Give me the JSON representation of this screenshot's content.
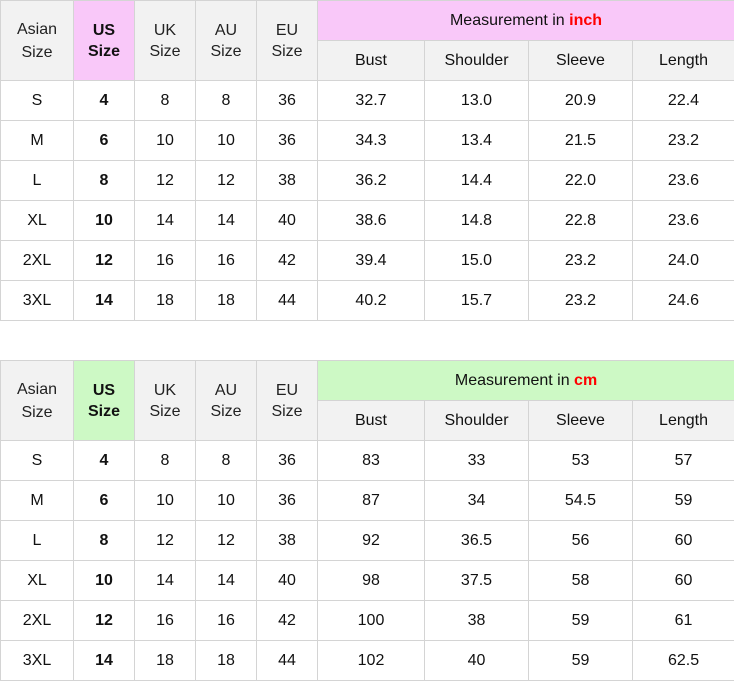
{
  "header": {
    "asian": [
      "Asian",
      "Size"
    ],
    "us": [
      "US",
      "Size"
    ],
    "uk": [
      "UK",
      "Size"
    ],
    "au": [
      "AU",
      "Size"
    ],
    "eu": [
      "EU",
      "Size"
    ],
    "measurement_prefix": "Measurement in",
    "sub_headers": [
      "Bust",
      "Shoulder",
      "Sleeve",
      "Length"
    ]
  },
  "tables": [
    {
      "unit": "inch",
      "accent_color": "#f9c8f9",
      "rows": [
        [
          "S",
          "4",
          "8",
          "8",
          "36",
          "32.7",
          "13.0",
          "20.9",
          "22.4"
        ],
        [
          "M",
          "6",
          "10",
          "10",
          "36",
          "34.3",
          "13.4",
          "21.5",
          "23.2"
        ],
        [
          "L",
          "8",
          "12",
          "12",
          "38",
          "36.2",
          "14.4",
          "22.0",
          "23.6"
        ],
        [
          "XL",
          "10",
          "14",
          "14",
          "40",
          "38.6",
          "14.8",
          "22.8",
          "23.6"
        ],
        [
          "2XL",
          "12",
          "16",
          "16",
          "42",
          "39.4",
          "15.0",
          "23.2",
          "24.0"
        ],
        [
          "3XL",
          "14",
          "18",
          "18",
          "44",
          "40.2",
          "15.7",
          "23.2",
          "24.6"
        ]
      ]
    },
    {
      "unit": "cm",
      "accent_color": "#cdf9c5",
      "rows": [
        [
          "S",
          "4",
          "8",
          "8",
          "36",
          "83",
          "33",
          "53",
          "57"
        ],
        [
          "M",
          "6",
          "10",
          "10",
          "36",
          "87",
          "34",
          "54.5",
          "59"
        ],
        [
          "L",
          "8",
          "12",
          "12",
          "38",
          "92",
          "36.5",
          "56",
          "60"
        ],
        [
          "XL",
          "10",
          "14",
          "14",
          "40",
          "98",
          "37.5",
          "58",
          "60"
        ],
        [
          "2XL",
          "12",
          "16",
          "16",
          "42",
          "100",
          "38",
          "59",
          "61"
        ],
        [
          "3XL",
          "14",
          "18",
          "18",
          "44",
          "102",
          "40",
          "59",
          "62.5"
        ]
      ]
    }
  ]
}
